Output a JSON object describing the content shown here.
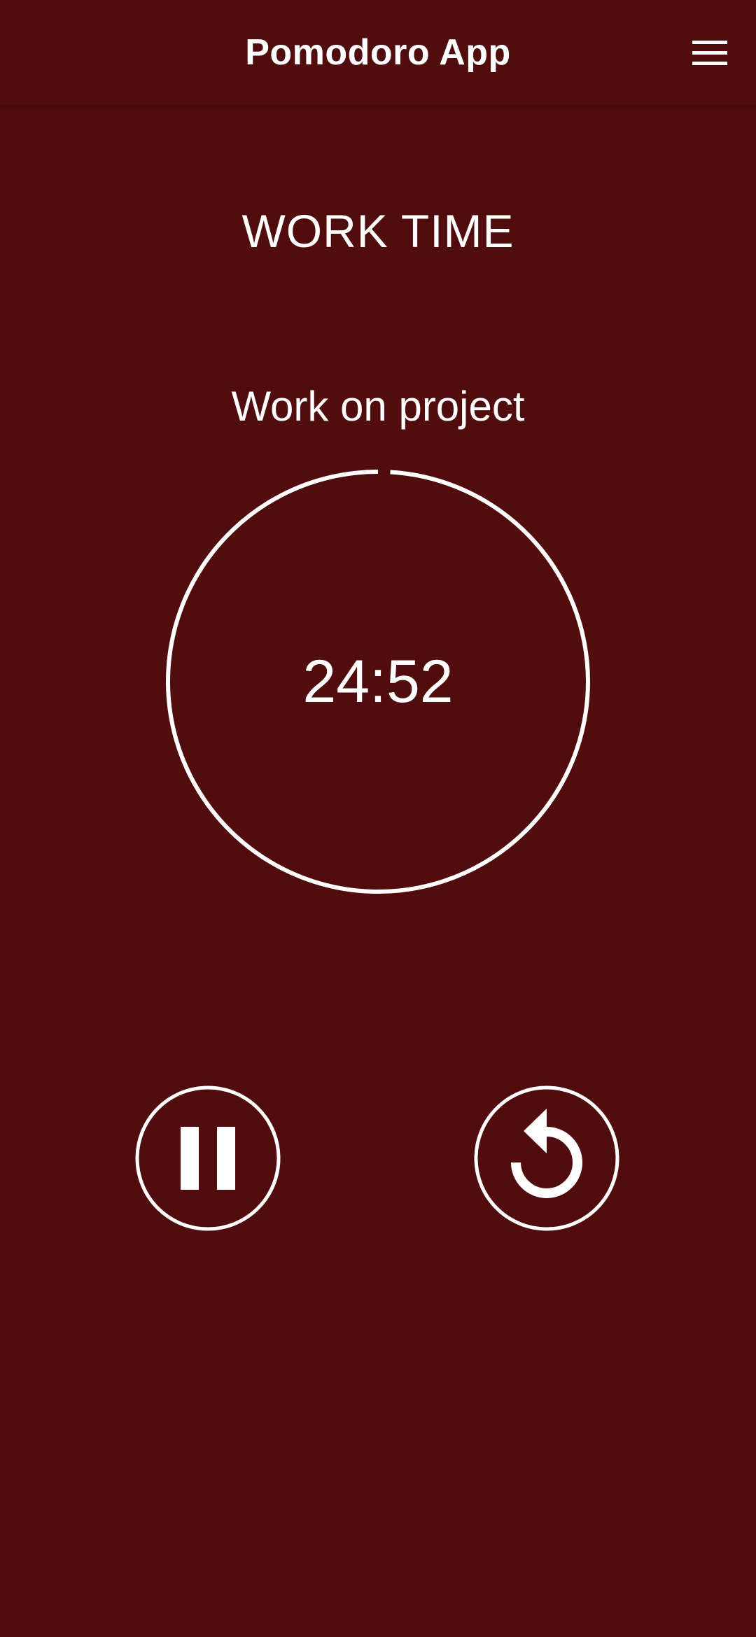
{
  "app_bar": {
    "title": "Pomodoro App",
    "menu_icon": "hamburger-menu-icon"
  },
  "session": {
    "phase_label": "WORK TIME",
    "task_name": "Work on project",
    "time_remaining": "24:52",
    "elapsed_fraction": 0.0093
  },
  "controls": {
    "pause_icon": "pause-icon",
    "reset_icon": "reset-icon"
  },
  "colors": {
    "background": "#510c0e",
    "foreground": "#ffffff"
  }
}
